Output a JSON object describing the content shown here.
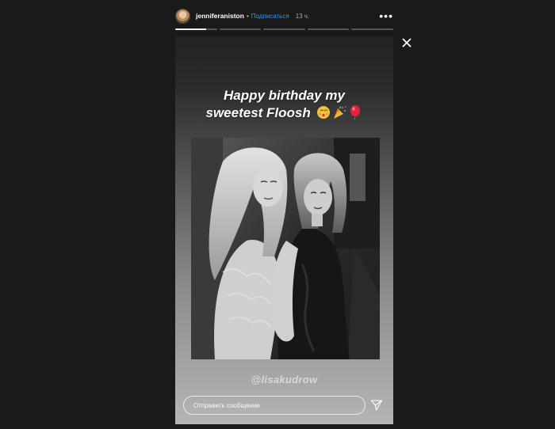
{
  "header": {
    "username": "jenniferaniston",
    "separator": "•",
    "follow_label": "Подписаться",
    "time_ago": "13 ч.",
    "more_icon": "more-horizontal-icon"
  },
  "progress": {
    "segments": 5,
    "current": 1,
    "current_fraction": 0.75
  },
  "story": {
    "caption_line1": "Happy birthday my",
    "caption_line2": "sweetest Floosh",
    "caption_emojis": [
      "kissing-face-emoji",
      "party-popper-emoji",
      "balloon-emoji"
    ],
    "mention": "@lisakudrow",
    "photo": "black-and-white photo of two women"
  },
  "reply": {
    "placeholder": "Отправить сообщение",
    "send_icon": "send-icon"
  },
  "close_icon": "close-icon",
  "colors": {
    "background": "#1a1a1a",
    "link": "#3897f0",
    "text": "#ffffff"
  }
}
